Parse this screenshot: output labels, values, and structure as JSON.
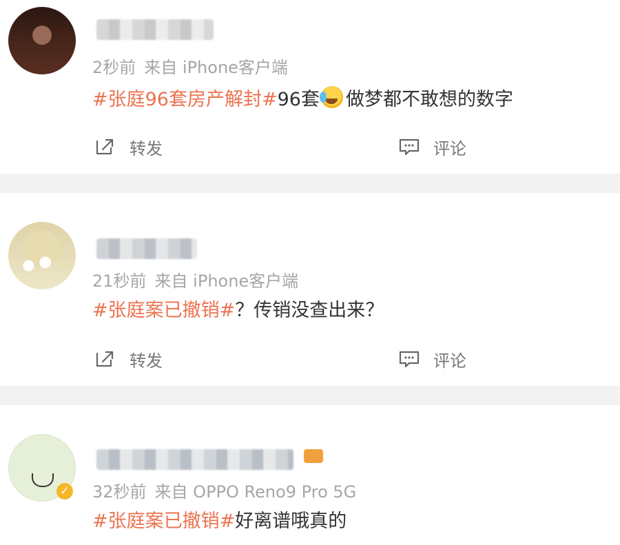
{
  "posts": [
    {
      "time": "2秒前",
      "source": "来自 iPhone客户端",
      "hashtag": "#张庭96套房产解封#",
      "text_before_emoji": "96套",
      "text_after_emoji": "做梦都不敢想的数字",
      "emoji": "cry-laugh-emoji",
      "actions": {
        "share": "转发",
        "comment": "评论"
      }
    },
    {
      "time": "21秒前",
      "source": "来自 iPhone客户端",
      "hashtag": "#张庭案已撤销#",
      "text": "？传销没查出来？",
      "actions": {
        "share": "转发",
        "comment": "评论"
      }
    },
    {
      "time": "32秒前",
      "source": "来自 OPPO Reno9 Pro 5G",
      "hashtag": "#张庭案已撤销#",
      "text": "好离谱哦真的"
    }
  ],
  "icons": {
    "share": "share-icon",
    "comment": "comment-icon",
    "verified": "verified-icon",
    "vip": "vip-badge-icon"
  },
  "colors": {
    "hashtag": "#eb7350",
    "meta": "#a6a6a6",
    "body": "#333333",
    "action": "#777777",
    "separator": "#f2f2f2",
    "verified": "#f5b727",
    "vip": "#f0a13d"
  }
}
